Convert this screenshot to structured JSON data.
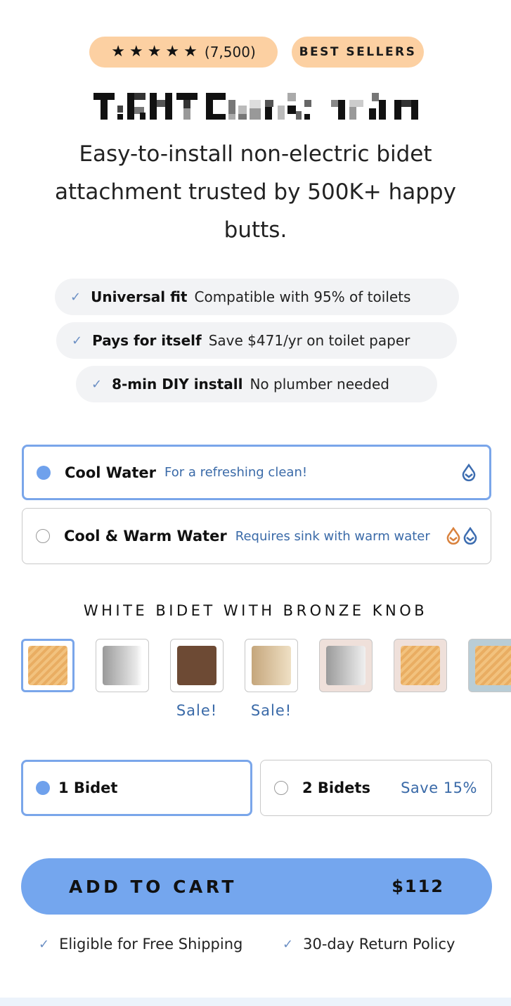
{
  "rating": {
    "stars": 5,
    "count_text": "(7,500)"
  },
  "best_sellers_badge": "BEST SELLERS",
  "product_title_obscured": true,
  "subtitle": "Easy-to-install non-electric bidet attachment trusted by 500K+ happy butts.",
  "features": [
    {
      "bold": "Universal fit",
      "text": "Compatible with 95% of toilets"
    },
    {
      "bold": "Pays for itself",
      "text": "Save $471/yr on toilet paper"
    },
    {
      "bold": "8-min DIY install",
      "text": "No plumber needed"
    }
  ],
  "water_options": [
    {
      "name": "Cool Water",
      "note": "For a refreshing clean!",
      "selected": true,
      "icons": [
        "cool-drop-icon"
      ]
    },
    {
      "name": "Cool & Warm Water",
      "note": "Requires sink with warm water",
      "selected": false,
      "icons": [
        "warm-drop-icon",
        "cool-drop-icon"
      ]
    }
  ],
  "finish": {
    "heading": "WHITE BIDET WITH BRONZE KNOB",
    "swatches": [
      {
        "name": "bronze-on-white",
        "selected": true,
        "sale": ""
      },
      {
        "name": "silver",
        "selected": false,
        "sale": ""
      },
      {
        "name": "brown",
        "selected": false,
        "sale": "Sale!"
      },
      {
        "name": "gold",
        "selected": false,
        "sale": "Sale!"
      },
      {
        "name": "silver-on-pink",
        "selected": false,
        "sale": ""
      },
      {
        "name": "bronze-on-pink",
        "selected": false,
        "sale": ""
      },
      {
        "name": "bronze-on-blue",
        "selected": false,
        "sale": ""
      }
    ]
  },
  "quantity": [
    {
      "label": "1 Bidet",
      "save": "",
      "selected": true
    },
    {
      "label": "2 Bidets",
      "save": "Save 15%",
      "selected": false
    }
  ],
  "cart": {
    "label": "ADD TO CART",
    "price": "$112"
  },
  "perks": [
    "Eligible for Free Shipping",
    "30-day Return Policy"
  ],
  "colors": {
    "accent": "#74a6ee",
    "badge": "#fcd0a2",
    "link_blue": "#3a6aa8",
    "warm": "#d9823e",
    "cool": "#3d6db0"
  }
}
